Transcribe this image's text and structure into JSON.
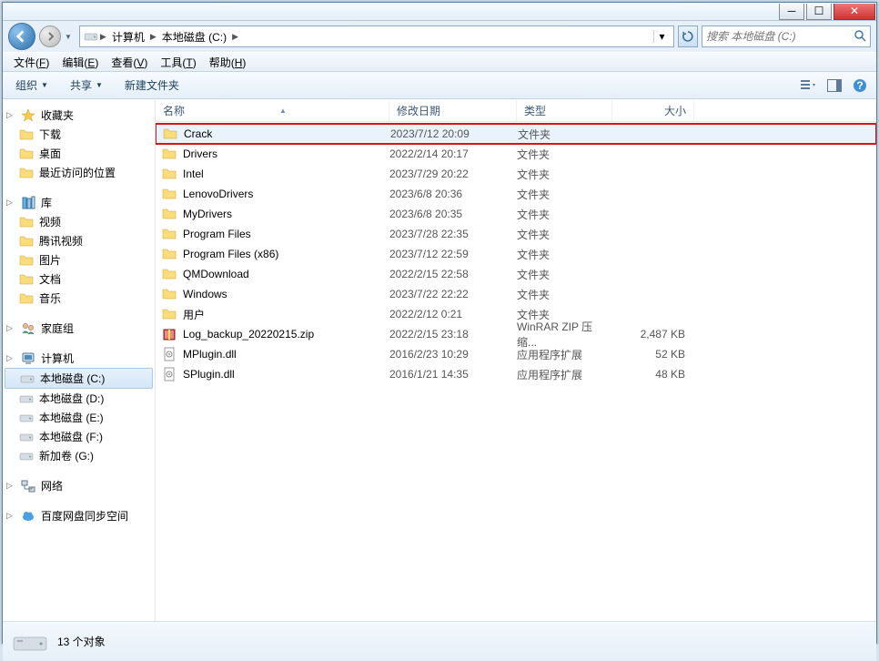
{
  "window_controls": {
    "min": "─",
    "max": "☐",
    "close": "✕"
  },
  "breadcrumbs": [
    "计算机",
    "本地磁盘 (C:)"
  ],
  "search": {
    "placeholder": "搜索 本地磁盘 (C:)"
  },
  "menubar": [
    {
      "label": "文件",
      "key": "F"
    },
    {
      "label": "编辑",
      "key": "E"
    },
    {
      "label": "查看",
      "key": "V"
    },
    {
      "label": "工具",
      "key": "T"
    },
    {
      "label": "帮助",
      "key": "H"
    }
  ],
  "toolbar": {
    "organize": "组织",
    "share": "共享",
    "newfolder": "新建文件夹"
  },
  "nav_pane": {
    "favorites": {
      "label": "收藏夹",
      "items": [
        "下载",
        "桌面",
        "最近访问的位置"
      ]
    },
    "libraries": {
      "label": "库",
      "items": [
        "视频",
        "腾讯视频",
        "图片",
        "文档",
        "音乐"
      ]
    },
    "homegroup": {
      "label": "家庭组"
    },
    "computer": {
      "label": "计算机",
      "items": [
        "本地磁盘 (C:)",
        "本地磁盘 (D:)",
        "本地磁盘 (E:)",
        "本地磁盘 (F:)",
        "新加卷 (G:)"
      ]
    },
    "network": {
      "label": "网络"
    },
    "baidu": {
      "label": "百度网盘同步空间"
    }
  },
  "columns": {
    "name": "名称",
    "date": "修改日期",
    "type": "类型",
    "size": "大小"
  },
  "files": [
    {
      "name": "Crack",
      "date": "2023/7/12 20:09",
      "type": "文件夹",
      "size": "",
      "icon": "folder",
      "hl": true,
      "hover": true
    },
    {
      "name": "Drivers",
      "date": "2022/2/14 20:17",
      "type": "文件夹",
      "size": "",
      "icon": "folder"
    },
    {
      "name": "Intel",
      "date": "2023/7/29 20:22",
      "type": "文件夹",
      "size": "",
      "icon": "folder"
    },
    {
      "name": "LenovoDrivers",
      "date": "2023/6/8 20:36",
      "type": "文件夹",
      "size": "",
      "icon": "folder"
    },
    {
      "name": "MyDrivers",
      "date": "2023/6/8 20:35",
      "type": "文件夹",
      "size": "",
      "icon": "folder"
    },
    {
      "name": "Program Files",
      "date": "2023/7/28 22:35",
      "type": "文件夹",
      "size": "",
      "icon": "folder"
    },
    {
      "name": "Program Files (x86)",
      "date": "2023/7/12 22:59",
      "type": "文件夹",
      "size": "",
      "icon": "folder"
    },
    {
      "name": "QMDownload",
      "date": "2022/2/15 22:58",
      "type": "文件夹",
      "size": "",
      "icon": "folder"
    },
    {
      "name": "Windows",
      "date": "2023/7/22 22:22",
      "type": "文件夹",
      "size": "",
      "icon": "folder"
    },
    {
      "name": "用户",
      "date": "2022/2/12 0:21",
      "type": "文件夹",
      "size": "",
      "icon": "folder"
    },
    {
      "name": "Log_backup_20220215.zip",
      "date": "2022/2/15 23:18",
      "type": "WinRAR ZIP 压缩...",
      "size": "2,487 KB",
      "icon": "zip"
    },
    {
      "name": "MPlugin.dll",
      "date": "2016/2/23 10:29",
      "type": "应用程序扩展",
      "size": "52 KB",
      "icon": "dll"
    },
    {
      "name": "SPlugin.dll",
      "date": "2016/1/21 14:35",
      "type": "应用程序扩展",
      "size": "48 KB",
      "icon": "dll"
    }
  ],
  "status": {
    "count": "13 个对象"
  }
}
